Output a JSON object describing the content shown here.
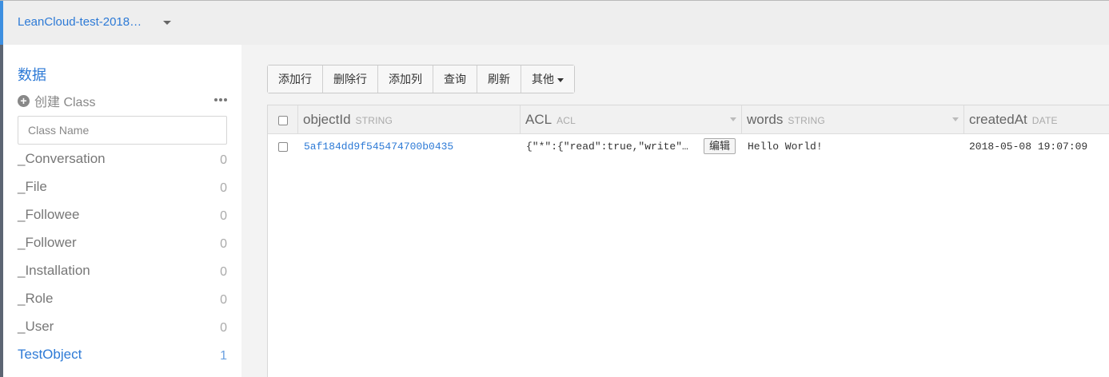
{
  "app": {
    "name": "LeanCloud-test-2018…"
  },
  "sidebar": {
    "title": "数据",
    "create_label": "创建 Class",
    "search_placeholder": "Class Name",
    "classes": [
      {
        "name": "_Conversation",
        "count": "0"
      },
      {
        "name": "_File",
        "count": "0"
      },
      {
        "name": "_Followee",
        "count": "0"
      },
      {
        "name": "_Follower",
        "count": "0"
      },
      {
        "name": "_Installation",
        "count": "0"
      },
      {
        "name": "_Role",
        "count": "0"
      },
      {
        "name": "_User",
        "count": "0"
      },
      {
        "name": "TestObject",
        "count": "1",
        "active": true
      }
    ]
  },
  "toolbar": {
    "add_row": "添加行",
    "delete_row": "删除行",
    "add_column": "添加列",
    "query": "查询",
    "refresh": "刷新",
    "more": "其他"
  },
  "table": {
    "columns": [
      {
        "name": "objectId",
        "type": "STRING"
      },
      {
        "name": "ACL",
        "type": "ACL"
      },
      {
        "name": "words",
        "type": "STRING"
      },
      {
        "name": "createdAt",
        "type": "DATE"
      }
    ],
    "rows": [
      {
        "objectId": "5af184dd9f545474700b0435",
        "acl": "{\"*\":{\"read\":true,\"write\"…",
        "edit_label": "编辑",
        "words": "Hello World!",
        "createdAt": "2018-05-08 19:07:09"
      }
    ]
  },
  "colors": {
    "accent": "#2d7ad6",
    "sidebar_strip": "#5c6573",
    "main_bg": "#f3f3f3"
  }
}
